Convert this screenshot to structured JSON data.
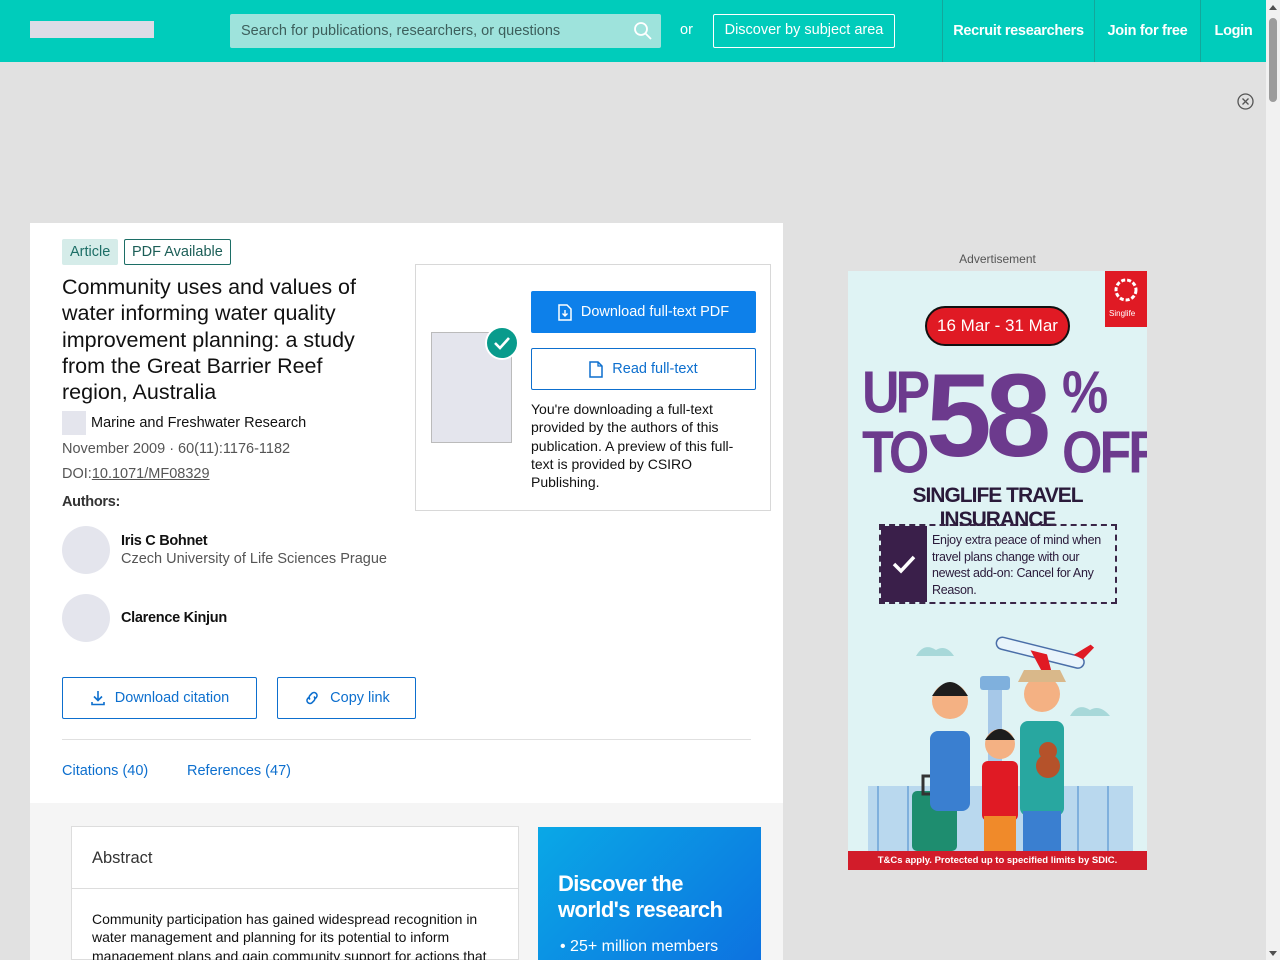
{
  "header": {
    "search_placeholder": "Search for publications, researchers, or questions",
    "or_text": "or",
    "discover_label": "Discover by subject area",
    "nav": [
      "Recruit researchers",
      "Join for free",
      "Login"
    ]
  },
  "article": {
    "tag_type": "Article",
    "tag_pdf": "PDF Available",
    "title": "Community uses and values of water informing water quality improvement planning: a study from the Great Barrier Reef region, Australia",
    "journal": "Marine and Freshwater Research",
    "pub_info": "November 2009 · 60(11):1176-1182",
    "doi_prefix": "DOI:",
    "doi": "10.1071/MF08329",
    "authors_heading": "Authors:",
    "authors": [
      {
        "name": "Iris C Bohnet",
        "affiliation": "Czech University of Life Sciences Prague"
      },
      {
        "name": "Clarence Kinjun",
        "affiliation": ""
      }
    ],
    "download_citation": "Download citation",
    "copy_link": "Copy link",
    "tabs": [
      "Citations (40)",
      "References (47)"
    ]
  },
  "download_box": {
    "download_pdf": "Download full-text PDF",
    "read_full": "Read full-text",
    "note": "You're downloading a full-text provided by the authors of this publication. A preview of this full-text is provided by CSIRO Publishing."
  },
  "abstract": {
    "heading": "Abstract",
    "text": "Community participation has gained widespread recognition in water management and planning for its potential to inform management plans and gain community support for actions that"
  },
  "promo": {
    "title": "Discover the world's research",
    "bullet": "25+ million members"
  },
  "ad": {
    "label": "Advertisement",
    "date": "16 Mar - 31 Mar",
    "big_left": "UP TO",
    "big_mid": "58",
    "big_right": "% OFF",
    "sub": "SINGLIFE TRAVEL INSURANCE",
    "box_text": "Enjoy extra peace of mind when travel plans change with our newest add-on: Cancel for Any Reason.",
    "logo_text": "Singlife",
    "footer": "T&Cs apply. Protected up to specified limits by SDIC."
  },
  "colors": {
    "brand": "#00ccbb",
    "link": "#0d6fce",
    "primary_button": "#0d80ea",
    "ad_purple": "#6c3a8d",
    "ad_red": "#e01a24"
  }
}
